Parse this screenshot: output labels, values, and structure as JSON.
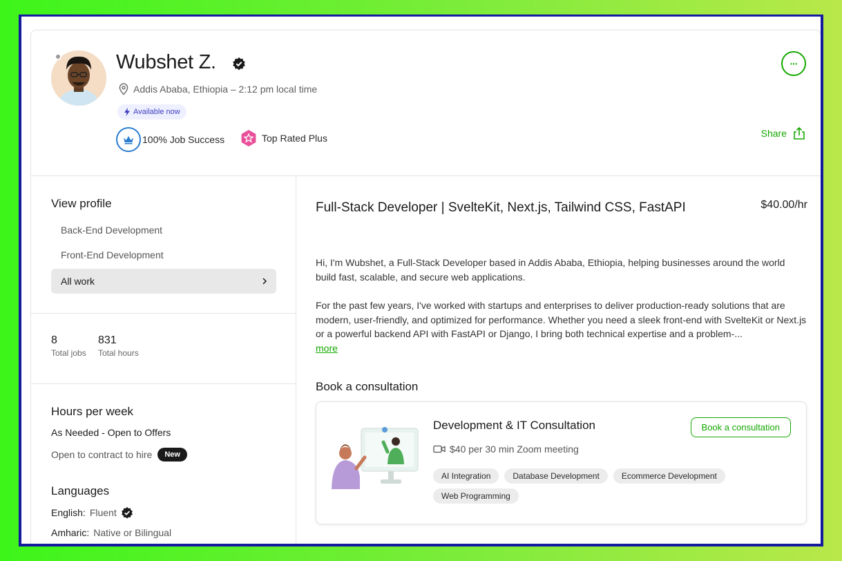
{
  "profile": {
    "name": "Wubshet Z.",
    "location": "Addis Ababa, Ethiopia – 2:12 pm local time",
    "availability": "Available now",
    "job_success": "100% Job Success",
    "top_rated": "Top Rated Plus",
    "share_label": "Share",
    "more_label": "···"
  },
  "sidebar": {
    "view_profile_title": "View profile",
    "profile_items": [
      "Back-End Development",
      "Front-End Development",
      "All work"
    ],
    "stats": [
      {
        "value": "8",
        "label": "Total jobs"
      },
      {
        "value": "831",
        "label": "Total hours"
      }
    ],
    "hours_title": "Hours per week",
    "hours_value": "As Needed - Open to Offers",
    "contract_label": "Open to contract to hire",
    "new_badge": "New",
    "languages_title": "Languages",
    "languages": [
      {
        "name": "English:",
        "level": "Fluent"
      },
      {
        "name": "Amharic:",
        "level": "Native or Bilingual"
      }
    ]
  },
  "main": {
    "title": "Full-Stack Developer | SvelteKit, Next.js, Tailwind CSS, FastAPI",
    "rate": "$40.00/hr",
    "bio_p1": "Hi, I'm Wubshet, a Full-Stack Developer based in Addis Ababa, Ethiopia, helping businesses around the world build fast, scalable, and secure web applications.",
    "bio_p2": "For the past few years, I've worked with startups and enterprises to deliver production-ready solutions that are modern, user-friendly, and optimized for performance. Whether you need a sleek front-end with SvelteKit or Next.js or a powerful backend API with FastAPI or Django, I bring both technical expertise and a problem-...",
    "more_label": "more",
    "consultation_heading": "Book a consultation",
    "consultation": {
      "title": "Development & IT Consultation",
      "button": "Book a consultation",
      "price": "$40 per 30 min Zoom meeting",
      "tags": [
        "AI Integration",
        "Database Development",
        "Ecommerce Development",
        "Web Programming"
      ]
    }
  },
  "colors": {
    "accent": "#14a800",
    "frame": "#141b9e",
    "badge_pink": "#e8519a",
    "jss_blue": "#2a7ccf"
  }
}
